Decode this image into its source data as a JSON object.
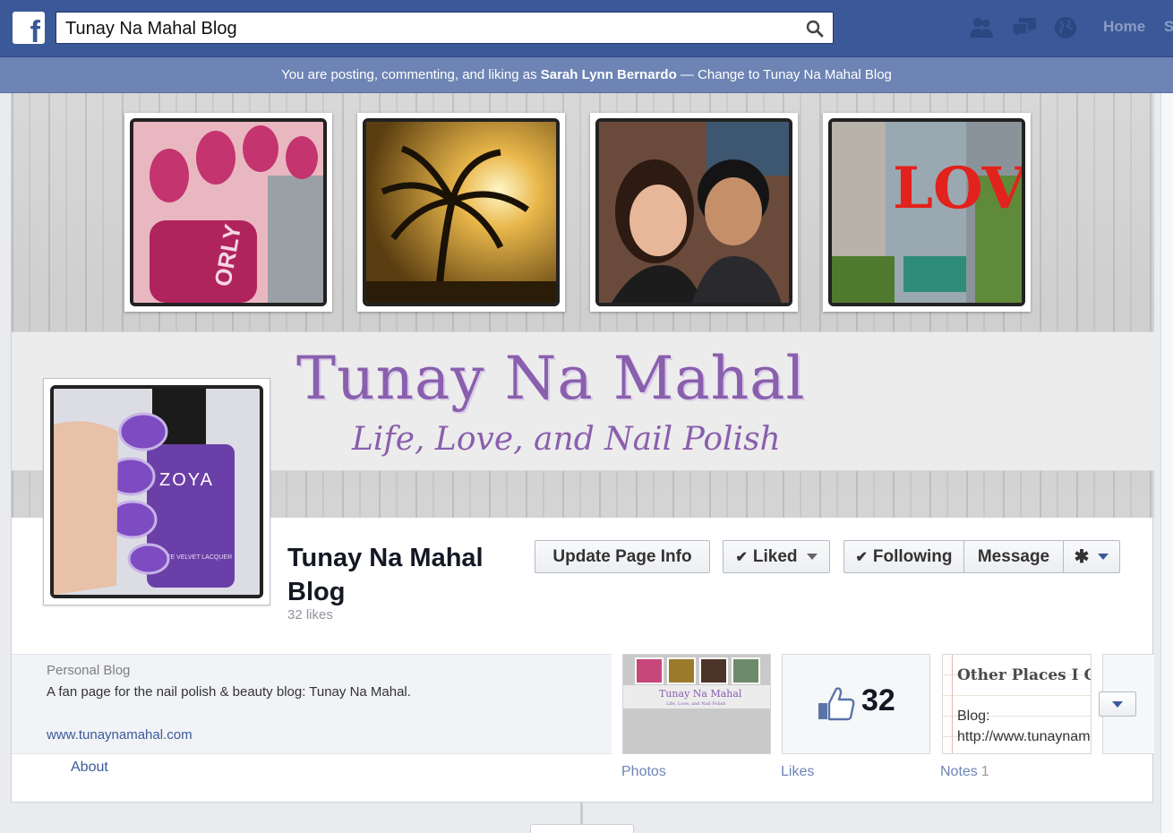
{
  "topbar": {
    "logo": "f",
    "search_value": "Tunay Na Mahal Blog",
    "home_label": "Home",
    "home_extra": "S"
  },
  "posting_bar": {
    "prefix": "You are posting, commenting, and liking as ",
    "user": "Sarah Lynn Bernardo",
    "suffix": " — Change to Tunay Na Mahal Blog"
  },
  "cover": {
    "title": "Tunay Na Mahal",
    "tagline": "Life, Love, and Nail Polish",
    "polish_label": "ORLY",
    "love_sculpture": "LOVE"
  },
  "profile": {
    "polish_brand": "ZOYA",
    "polish_sub": "MATTE VELVET LACQUER"
  },
  "page": {
    "name": "Tunay Na Mahal Blog",
    "likes": "32 likes"
  },
  "buttons": {
    "update": "Update Page Info",
    "liked": "Liked",
    "following": "Following",
    "message": "Message"
  },
  "about": {
    "category": "Personal Blog",
    "description": "A fan page for the nail polish & beauty blog: Tunay Na Mahal.",
    "url": "www.tunaynamahal.com",
    "label": "About"
  },
  "tiles": {
    "photos_label": "Photos",
    "photos_thumb_title": "Tunay Na Mahal",
    "photos_thumb_sub": "Life, Love, and Nail Polish",
    "likes_label": "Likes",
    "likes_number": "32",
    "notes_label": "Notes",
    "notes_count": "1",
    "notes_title": "Other Places I Can Be Found",
    "notes_line1": "Blog:",
    "notes_line2": "http://www.tunaynamahal.com"
  },
  "colors": {
    "fb_blue": "#3b5998",
    "posting_bar": "#6d84b4",
    "cover_purple": "#8a5fae"
  }
}
